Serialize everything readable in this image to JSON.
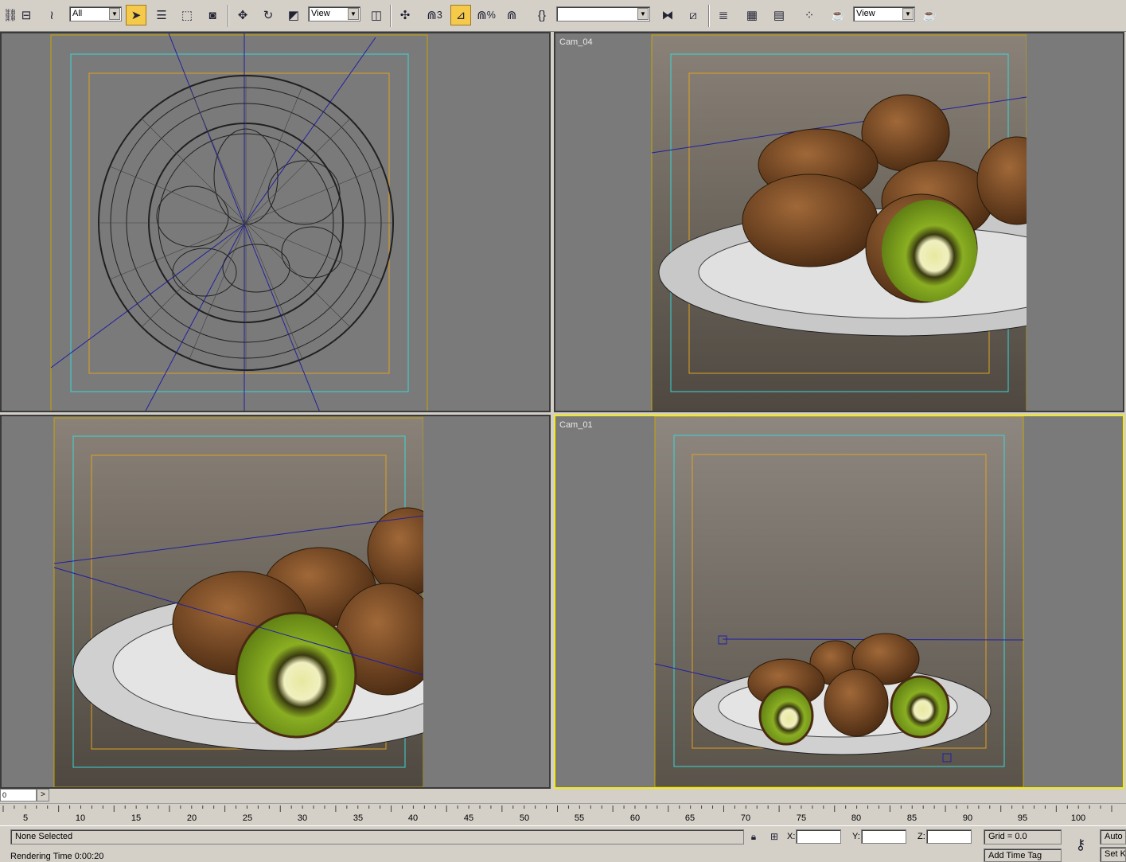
{
  "toolbar": {
    "filter_dropdown": "All",
    "ref_coord_dropdown": "View",
    "named_selection_dropdown": "",
    "view_dropdown_2": "View",
    "snap_label": "3",
    "percent_snap_label": "%"
  },
  "viewports": {
    "top_left": {
      "label": ""
    },
    "top_right": {
      "label": "Cam_04"
    },
    "bottom_left": {
      "label": ""
    },
    "bottom_right": {
      "label": "Cam_01"
    }
  },
  "timeslider": {
    "frame_field": "0",
    "next_arrow": ">"
  },
  "trackbar": {
    "ticks": [
      "5",
      "10",
      "15",
      "20",
      "25",
      "30",
      "35",
      "40",
      "45",
      "50",
      "55",
      "60",
      "65",
      "70",
      "75",
      "80",
      "85",
      "90",
      "95",
      "100"
    ]
  },
  "status": {
    "selection": "None Selected",
    "rendering_time": "Rendering Time  0:00:20",
    "x_label": "X:",
    "y_label": "Y:",
    "z_label": "Z:",
    "grid": "Grid = 0.0",
    "add_time_tag": "Add Time Tag",
    "auto_key": "Auto K",
    "set_key": "Set K"
  },
  "colors": {
    "viewport_bg": "#7a7a7a",
    "active_border": "#f2ea1a",
    "safe_frame_outer": "#c8a400",
    "safe_frame_action": "#3ad6d6",
    "safe_frame_title": "#e0a020",
    "kiwi_skin": "#7a4a24",
    "kiwi_flesh": "#7da21e"
  }
}
